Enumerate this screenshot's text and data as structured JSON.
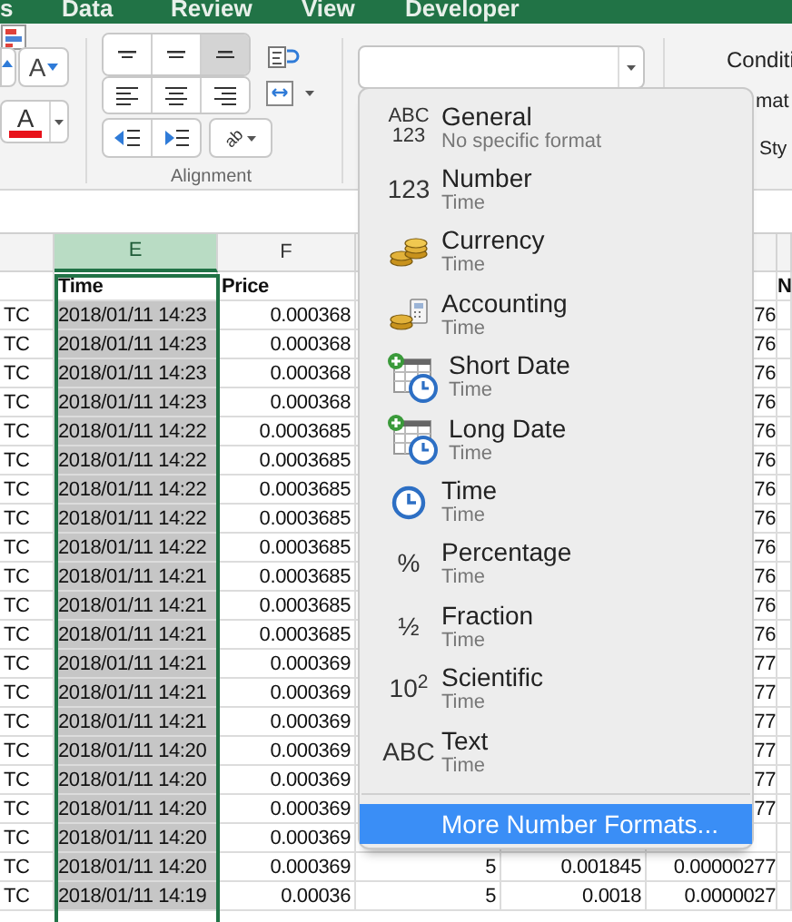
{
  "ribbon_tabs": [
    "s",
    "Data",
    "Review",
    "View",
    "Developer"
  ],
  "font": {
    "shrink_label": "A",
    "color_label": "A"
  },
  "alignment": {
    "vertical": [
      {
        "kind": "top",
        "selected": false
      },
      {
        "kind": "middle",
        "selected": false
      },
      {
        "kind": "bottom",
        "selected": true
      }
    ],
    "horizontal": [
      {
        "kind": "left",
        "selected": false
      },
      {
        "kind": "center",
        "selected": false
      },
      {
        "kind": "right",
        "selected": false
      }
    ],
    "orientation_glyph": "ab",
    "label": "Alignment"
  },
  "styles": [
    "Conditi",
    "mat",
    "Sty"
  ],
  "format_menu": {
    "items": [
      {
        "kind": "glyph",
        "glyph": [
          "ABC",
          "123"
        ],
        "title": "General",
        "subtitle": "No specific format"
      },
      {
        "kind": "glyph",
        "glyph": [
          "123"
        ],
        "title": "Number",
        "subtitle": "Time"
      },
      {
        "kind": "coins",
        "title": "Currency",
        "subtitle": "Time"
      },
      {
        "kind": "coins-calculator",
        "title": "Accounting",
        "subtitle": "Time"
      },
      {
        "kind": "calendar-clock",
        "title": "Short Date",
        "subtitle": "Time"
      },
      {
        "kind": "calendar-clock",
        "title": "Long Date",
        "subtitle": "Time"
      },
      {
        "kind": "clock",
        "title": "Time",
        "subtitle": "Time"
      },
      {
        "kind": "glyph",
        "glyph": [
          "%"
        ],
        "title": "Percentage",
        "subtitle": "Time"
      },
      {
        "kind": "glyph",
        "glyph": [
          "½"
        ],
        "title": "Fraction",
        "subtitle": "Time"
      },
      {
        "kind": "glyph",
        "glyph": [
          "10$^{2}$"
        ],
        "title": "Scientific",
        "subtitle": "Time"
      },
      {
        "kind": "glyph",
        "glyph": [
          "ABC"
        ],
        "title": "Text",
        "subtitle": "Time"
      }
    ],
    "footer": {
      "label": "More Number Formats...",
      "selected": true
    }
  },
  "sheet": {
    "column_headers": [
      {
        "label": "E",
        "selected": true
      },
      {
        "label": "F",
        "selected": false
      }
    ],
    "header_row": {
      "time": "Time",
      "price": "Price",
      "column_j": "N"
    },
    "rows": [
      {
        "column_a": "TC",
        "time": "2018/01/11 14:23",
        "price": "0.000368",
        "column_i": "76"
      },
      {
        "column_a": "TC",
        "time": "2018/01/11 14:23",
        "price": "0.000368",
        "column_i": "76"
      },
      {
        "column_a": "TC",
        "time": "2018/01/11 14:23",
        "price": "0.000368",
        "column_i": "76"
      },
      {
        "column_a": "TC",
        "time": "2018/01/11 14:23",
        "price": "0.000368",
        "column_i": "76"
      },
      {
        "column_a": "TC",
        "time": "2018/01/11 14:22",
        "price": "0.0003685",
        "column_i": "76"
      },
      {
        "column_a": "TC",
        "time": "2018/01/11 14:22",
        "price": "0.0003685",
        "column_i": "76"
      },
      {
        "column_a": "TC",
        "time": "2018/01/11 14:22",
        "price": "0.0003685",
        "column_i": "76"
      },
      {
        "column_a": "TC",
        "time": "2018/01/11 14:22",
        "price": "0.0003685",
        "column_i": "76"
      },
      {
        "column_a": "TC",
        "time": "2018/01/11 14:22",
        "price": "0.0003685",
        "column_i": "76"
      },
      {
        "column_a": "TC",
        "time": "2018/01/11 14:21",
        "price": "0.0003685",
        "column_i": "76"
      },
      {
        "column_a": "TC",
        "time": "2018/01/11 14:21",
        "price": "0.0003685",
        "column_i": "76"
      },
      {
        "column_a": "TC",
        "time": "2018/01/11 14:21",
        "price": "0.0003685",
        "column_i": "76"
      },
      {
        "column_a": "TC",
        "time": "2018/01/11 14:21",
        "price": "0.000369",
        "column_i": "77"
      },
      {
        "column_a": "TC",
        "time": "2018/01/11 14:21",
        "price": "0.000369",
        "column_i": "77"
      },
      {
        "column_a": "TC",
        "time": "2018/01/11 14:21",
        "price": "0.000369",
        "column_i": "77"
      },
      {
        "column_a": "TC",
        "time": "2018/01/11 14:20",
        "price": "0.000369",
        "column_i": "77"
      },
      {
        "column_a": "TC",
        "time": "2018/01/11 14:20",
        "price": "0.000369",
        "column_i": "77"
      },
      {
        "column_a": "TC",
        "time": "2018/01/11 14:20",
        "price": "0.000369",
        "column_i": "77"
      },
      {
        "column_a": "TC",
        "time": "2018/01/11 14:20",
        "price": "0.000369"
      },
      {
        "column_a": "TC",
        "time": "2018/01/11 14:20",
        "price": "0.000369",
        "column_g": "5",
        "column_h": "0.001845",
        "column_i": "0.00000277"
      },
      {
        "column_a": "TC",
        "time": "2018/01/11 14:19",
        "price": "0.00036",
        "column_g": "5",
        "column_h": "0.0018",
        "column_i": "0.0000027"
      }
    ]
  }
}
